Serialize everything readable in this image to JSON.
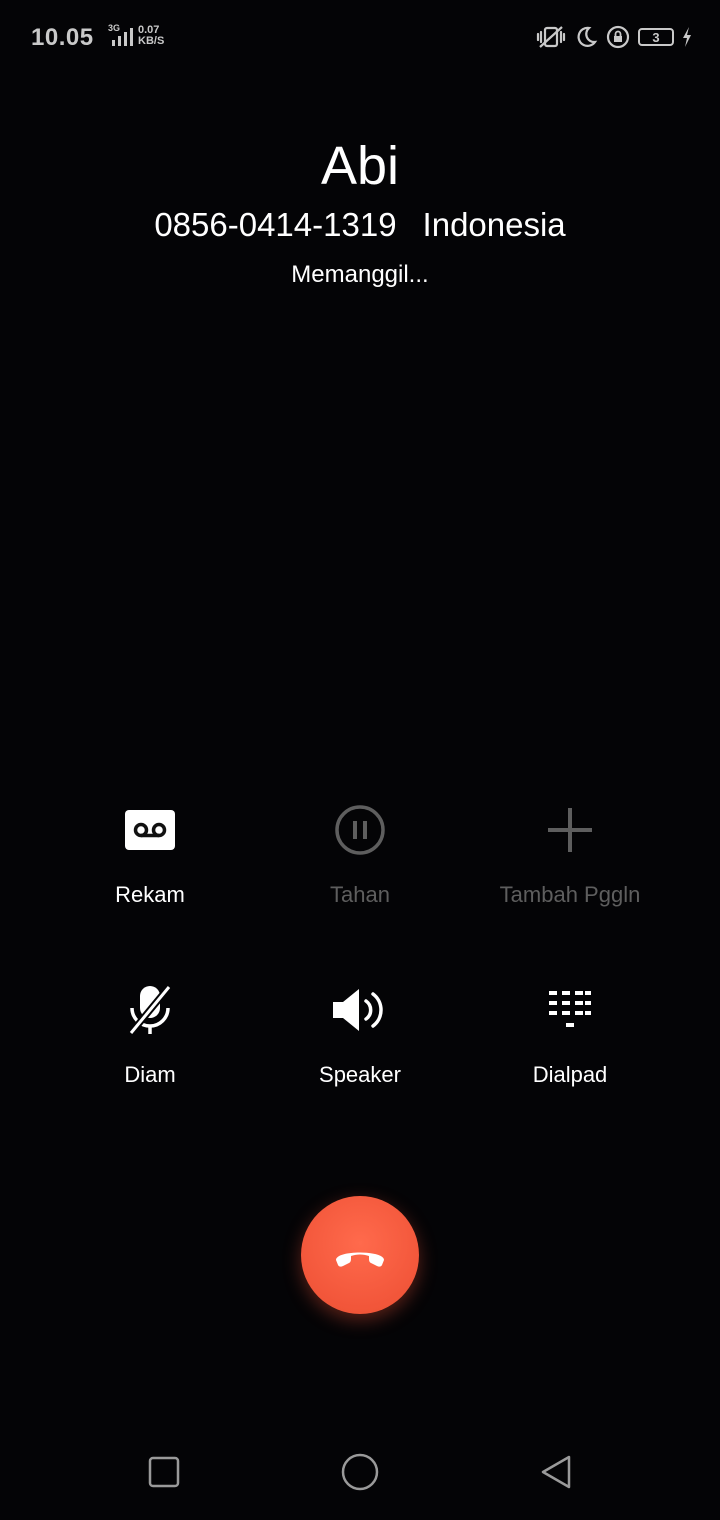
{
  "status_bar": {
    "time": "10.05",
    "network_type": "3G",
    "speed_value": "0.07",
    "speed_unit": "KB/S",
    "battery_level": "3",
    "icons": [
      "vibrate-icon",
      "moon-icon",
      "lock-rotation-icon",
      "battery-icon",
      "charging-icon"
    ]
  },
  "caller": {
    "name": "Abi",
    "number": "0856-0414-1319",
    "region": "Indonesia",
    "status": "Memanggil..."
  },
  "actions": {
    "record": {
      "label": "Rekam",
      "icon": "record-icon",
      "enabled": true
    },
    "hold": {
      "label": "Tahan",
      "icon": "pause-icon",
      "enabled": false
    },
    "add_call": {
      "label": "Tambah Pggln",
      "icon": "plus-icon",
      "enabled": false
    },
    "mute": {
      "label": "Diam",
      "icon": "mic-off-icon",
      "enabled": true
    },
    "speaker": {
      "label": "Speaker",
      "icon": "speaker-icon",
      "enabled": true
    },
    "dialpad": {
      "label": "Dialpad",
      "icon": "dialpad-icon",
      "enabled": true
    }
  },
  "end_call": {
    "icon": "phone-hangup-icon",
    "color": "#f2563a"
  },
  "nav_bar": {
    "icons": [
      "recents-square-icon",
      "home-circle-icon",
      "back-triangle-icon"
    ]
  },
  "colors": {
    "background": "#040406",
    "text": "#ffffff",
    "disabled": "#5e5e5e",
    "status": "#c9c9c9"
  }
}
